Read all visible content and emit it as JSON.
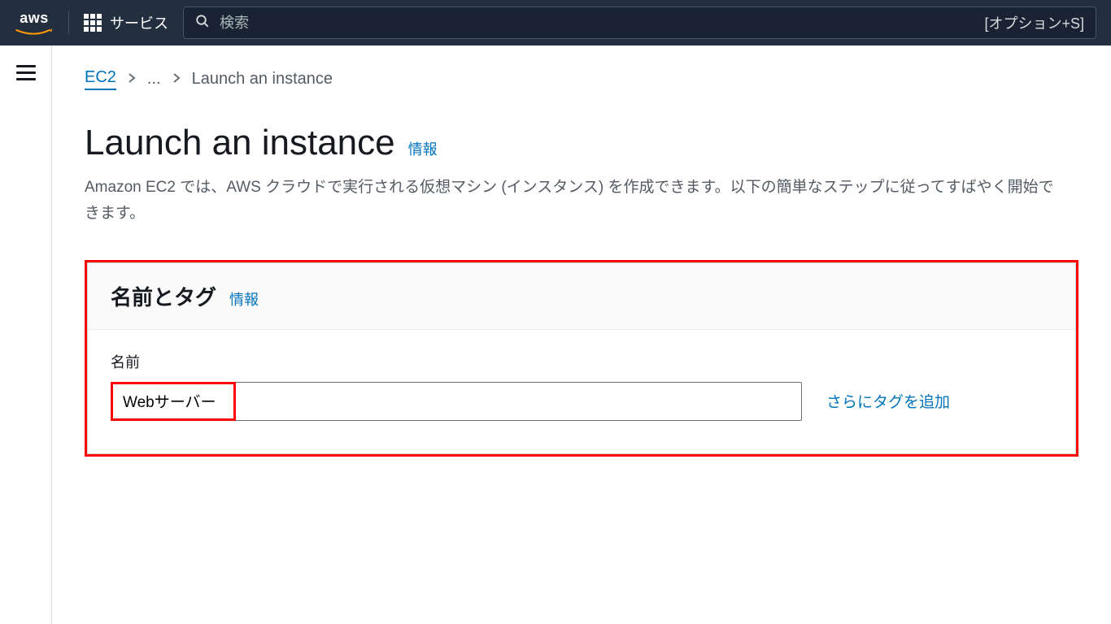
{
  "topnav": {
    "logo_text": "aws",
    "services_label": "サービス",
    "search_placeholder": "検索",
    "search_shortcut": "[オプション+S]"
  },
  "breadcrumb": {
    "root": "EC2",
    "ellipsis": "...",
    "current": "Launch an instance"
  },
  "page": {
    "title": "Launch an instance",
    "info_label": "情報",
    "description": "Amazon EC2 では、AWS クラウドで実行される仮想マシン (インスタンス) を作成できます。以下の簡単なステップに従ってすばやく開始できます。"
  },
  "panel": {
    "title": "名前とタグ",
    "info_label": "情報",
    "name_label": "名前",
    "name_value": "Webサーバー",
    "add_tags_label": "さらにタグを追加"
  }
}
